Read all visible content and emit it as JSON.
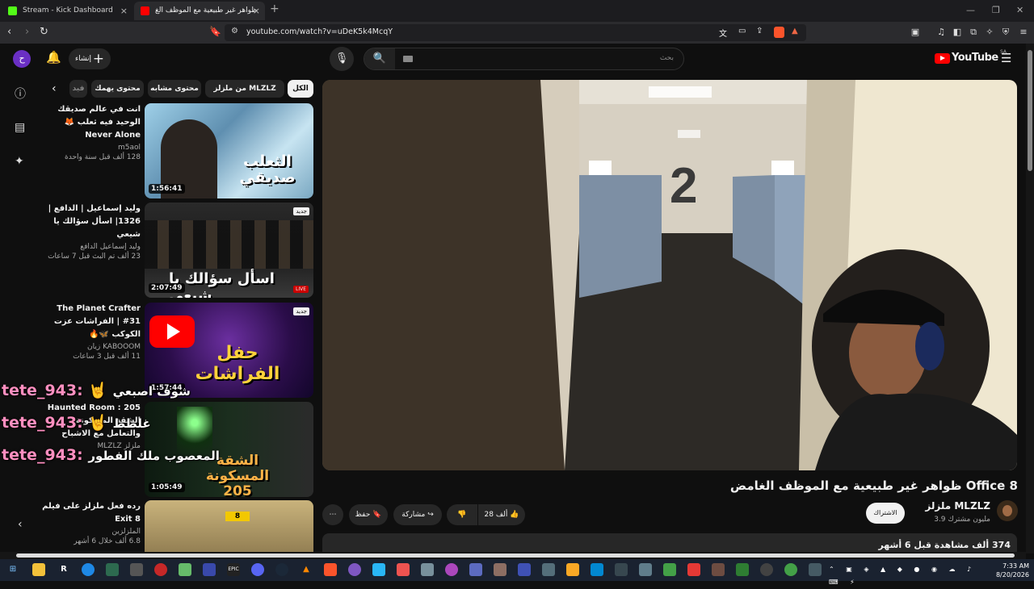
{
  "browser": {
    "tabs": [
      {
        "label": "Stream - Kick Dashboard",
        "favicon_color": "#53fc18"
      },
      {
        "label": "ظواهر غير طبيعية مع الموظف الغ",
        "favicon_color": "#ff0000"
      }
    ],
    "url": "youtube.com/watch?v=uDeK5k4McqY"
  },
  "header": {
    "logo": "YouTube",
    "country": "SA",
    "create_label": "إنشاء",
    "search_placeholder": "بحث",
    "avatar_letter": "ح"
  },
  "chips": [
    {
      "label": "الكل",
      "active": true
    },
    {
      "label": "من ملزلز MLZLZ",
      "active": false
    },
    {
      "label": "محتوى مشابه",
      "active": false
    },
    {
      "label": "محتوى يهمك",
      "active": false
    },
    {
      "label": "فيد",
      "active": false
    }
  ],
  "recommendations": [
    {
      "title": "انت في عالم صديقك الوحيد فيه ثعلب 🦊 Never Alone",
      "channel": "m5aol",
      "views": "128 ألف  قبل سنة واحدة",
      "duration": "1:56:41",
      "thumb_text": "الثعلب صديقي",
      "new": false
    },
    {
      "title": "وليد إسماعيل | الدافع | 1326| اسأل سؤالك يا شيعي",
      "channel": "وليد إسماعيل الدافع",
      "views": "23 ألف  تم البث قبل 7 ساعات",
      "duration": "2:07:49",
      "thumb_text": "اسأل سؤالك يا شيعي",
      "new": true,
      "badge": "جديد"
    },
    {
      "title": "The Planet Crafter #31 | الفراشات عزت الكوكب 🦋🔥",
      "channel": "KABOOOM زيان",
      "views": "11 ألف  قبل 3 ساعات",
      "duration": "1:57:44",
      "thumb_text": "حفل الفراشات",
      "new": true,
      "badge": "جديد"
    },
    {
      "title": "Haunted Room : 205 الشقة المسكونة والتعامل مع الاشباح",
      "channel": "ملزلز MLZLZ",
      "views": "",
      "duration": "1:05:49",
      "thumb_text": "الشقة المسكونة 205",
      "new": false
    },
    {
      "title": "رده فعل ملزلز على فيلم Exit 8",
      "channel": "الملزلزين",
      "views": "6.8 ألف  خلال 6 أشهر",
      "duration": "",
      "thumb_text": "8",
      "new": false
    }
  ],
  "chat": [
    {
      "user": "tete_943:",
      "emoji": "🤘",
      "message": "شوف اصبعي"
    },
    {
      "user": "tete_943:",
      "emoji": "🤘",
      "message": "غلطط"
    },
    {
      "user": "tete_943:",
      "emoji": "",
      "message": "المعصوب ملك الفطور"
    }
  ],
  "video": {
    "title": "ظواهر غير طبيعية مع الموظف الغامض Office 8",
    "channel": "ملزلز MLZLZ",
    "subscribers": "3.9 مليون مشترك",
    "subscribe_label": "الاشتراك",
    "like_count": "28 ألف",
    "share_label": "مشاركة",
    "save_label": "حفظ",
    "description_meta": "374 ألف مشاهدة  قبل 6 أشهر"
  },
  "taskbar": {
    "time": "7:33 AM",
    "date": "8/20/2026"
  }
}
